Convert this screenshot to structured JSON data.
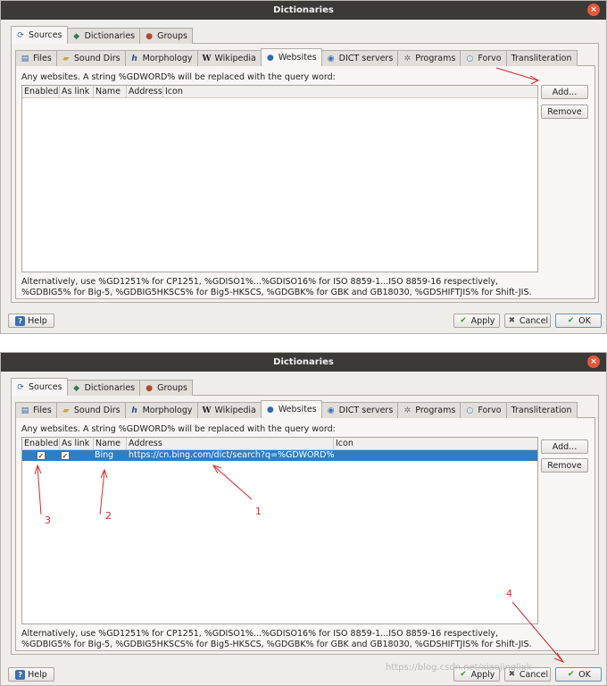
{
  "window": {
    "title": "Dictionaries",
    "close_glyph": "×"
  },
  "top_tabs": [
    {
      "label": "Sources",
      "icon": "refresh-icon",
      "active": true
    },
    {
      "label": "Dictionaries",
      "icon": "book-icon",
      "active": false
    },
    {
      "label": "Groups",
      "icon": "groups-icon",
      "active": false
    }
  ],
  "sub_tabs": [
    {
      "label": "Files",
      "icon": "file-icon",
      "active": false
    },
    {
      "label": "Sound Dirs",
      "icon": "folder-icon",
      "active": false
    },
    {
      "label": "Morphology",
      "icon": "h-icon",
      "active": false
    },
    {
      "label": "Wikipedia",
      "icon": "w-icon",
      "active": false
    },
    {
      "label": "Websites",
      "icon": "globe-icon",
      "active": true
    },
    {
      "label": "DICT servers",
      "icon": "server-icon",
      "active": false
    },
    {
      "label": "Programs",
      "icon": "gear-icon",
      "active": false
    },
    {
      "label": "Forvo",
      "icon": "forvo-icon",
      "active": false
    },
    {
      "label": "Transliteration",
      "icon": "",
      "active": false
    }
  ],
  "websites": {
    "description": "Any websites. A string %GDWORD% will be replaced with the query word:",
    "columns": [
      "Enabled",
      "As link",
      "Name",
      "Address",
      "Icon"
    ],
    "rows_step1": [],
    "rows_step2": [
      {
        "enabled": true,
        "as_link": true,
        "name": "Bing",
        "address": "https://cn.bing.com/dict/search?q=%GDWORD%",
        "icon": ""
      }
    ],
    "check_glyph": "✓",
    "add_button": "Add...",
    "remove_button": "Remove",
    "footnote_line1": "Alternatively, use %GD1251% for CP1251, %GDISO1%...%GDISO16% for ISO 8859-1...ISO 8859-16 respectively,",
    "footnote_line2": "%GDBIG5% for Big-5, %GDBIG5HKSCS% for Big5-HKSCS, %GDGBK% for GBK and GB18030, %GDSHIFTJIS% for Shift-JIS."
  },
  "bottom_buttons": {
    "help": "Help",
    "apply": "Apply",
    "cancel": "Cancel",
    "ok": "OK"
  },
  "annotations": {
    "labels": [
      "1",
      "2",
      "3",
      "4"
    ],
    "color": "#d42a2a"
  },
  "watermark": "https://blog.csdn.net/xiaojinglixk"
}
